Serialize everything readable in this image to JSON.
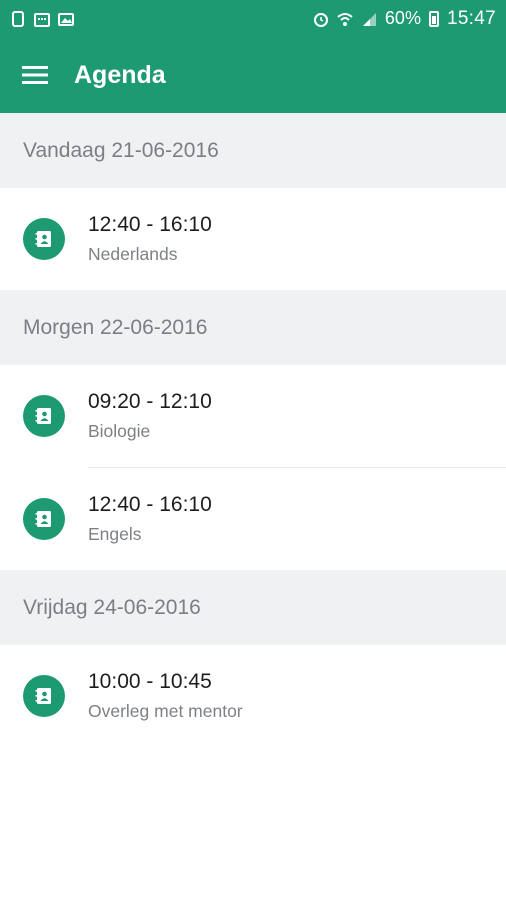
{
  "status_bar": {
    "battery_percent": "60%",
    "time": "15:47",
    "left_icons": [
      "phone-icon",
      "calendar-icon",
      "image-icon"
    ],
    "right_icons": [
      "alarm-icon",
      "wifi-icon",
      "signal-icon",
      "battery-icon"
    ]
  },
  "toolbar": {
    "title": "Agenda",
    "menu_icon": "hamburger-menu-icon"
  },
  "colors": {
    "primary": "#1e9a72",
    "section_bg": "#f0f1f3",
    "secondary_text": "#7d8186"
  },
  "sections": [
    {
      "header": "Vandaag 21-06-2016",
      "items": [
        {
          "time": "12:40 - 16:10",
          "subject": "Nederlands"
        }
      ]
    },
    {
      "header": "Morgen 22-06-2016",
      "items": [
        {
          "time": "09:20 - 12:10",
          "subject": "Biologie"
        },
        {
          "time": "12:40 - 16:10",
          "subject": "Engels"
        }
      ]
    },
    {
      "header": "Vrijdag 24-06-2016",
      "items": [
        {
          "time": "10:00 - 10:45",
          "subject": "Overleg met mentor"
        }
      ]
    }
  ]
}
